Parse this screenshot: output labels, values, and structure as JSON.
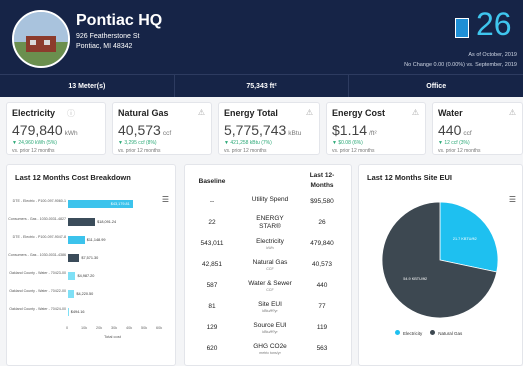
{
  "building": {
    "name": "Pontiac HQ",
    "address1": "926 Featherstone St",
    "address2": "Pontiac, MI 48342"
  },
  "energy_star": {
    "score": "26",
    "as_of": "As of October, 2019",
    "change": "No Change 0.00 (0.00%) vs. September, 2019"
  },
  "stats": {
    "meters": "13 Meter(s)",
    "area": "75,343 ft²",
    "type": "Office"
  },
  "cards": [
    {
      "title": "Electricity",
      "value": "479,840",
      "unit": "kWh",
      "change": "▼ 24,960 kWh (5%)",
      "period": "vs. prior 12 months"
    },
    {
      "title": "Natural Gas",
      "value": "40,573",
      "unit": "ccf",
      "change": "▼ 3,295 ccf (8%)",
      "period": "vs. prior 12 months"
    },
    {
      "title": "Energy Total",
      "value": "5,775,743",
      "unit": "kBtu",
      "change": "▼ 421,258 kBtu (7%)",
      "period": "vs. prior 12 months"
    },
    {
      "title": "Energy Cost",
      "value": "$1.14",
      "unit": "/ft²",
      "change": "▼ $0.08 (6%)",
      "period": "vs. prior 12 months"
    },
    {
      "title": "Water",
      "value": "440",
      "unit": "ccf",
      "change": "▼ 12 ccf (3%)",
      "period": "vs. prior 12 months"
    }
  ],
  "cost_panel": {
    "title": "Last 12 Months Cost Breakdown",
    "xaxis_title": "Total cost"
  },
  "table": {
    "head_baseline": "Baseline",
    "head_last_a": "Last 12-",
    "head_last_b": "Months",
    "rows": [
      {
        "baseline": "--",
        "metric": "Utility Spend",
        "sub": "",
        "last": "$95,580"
      },
      {
        "baseline": "22",
        "metric": "ENERGY STAR®",
        "sub": "",
        "last": "26"
      },
      {
        "baseline": "543,011",
        "metric": "Electricity",
        "sub": "kWh",
        "last": "479,840"
      },
      {
        "baseline": "42,851",
        "metric": "Natural Gas",
        "sub": "CCF",
        "last": "40,573"
      },
      {
        "baseline": "587",
        "metric": "Water & Sewer",
        "sub": "CCF",
        "last": "440"
      },
      {
        "baseline": "81",
        "metric": "Site EUI",
        "sub": "kBtu/ft²/yr",
        "last": "77"
      },
      {
        "baseline": "129",
        "metric": "Source EUI",
        "sub": "kBtu/ft²/yr",
        "last": "119"
      },
      {
        "baseline": "620",
        "metric": "GHG CO2e",
        "sub": "metric tons/yr",
        "last": "563"
      }
    ]
  },
  "eui_panel": {
    "title": "Last 12 Months Site EUI"
  },
  "chart_data": [
    {
      "type": "bar",
      "title": "Last 12 Months Cost Breakdown",
      "xlabel": "Total cost",
      "categories": [
        "DTE - Electric - P100-097-9060-1",
        "Consumers - Gas - 1030-0031-4827",
        "DTE - Electric - P100-097-9047-8",
        "Consumers - Gas - 1030-0031-4386",
        "Oakland County - Water - 70423-00",
        "Oakland County - Water - 70422-00",
        "Oakland County - Water - 70424-00"
      ],
      "values": [
        43179.81,
        18091.24,
        11148.99,
        7571.3,
        4987.2,
        4220.5,
        494.16
      ],
      "value_labels": [
        "$43,179.81",
        "$18,091.24",
        "$11,148.99",
        "$7,571.30",
        "$4,987.20",
        "$4,220.50",
        "$494.16"
      ],
      "colors": [
        "#3cc3ec",
        "#3b4c5a",
        "#3cc3ec",
        "#3b4c5a",
        "#7fe0f6",
        "#7fe0f6",
        "#7fe0f6"
      ],
      "xticks": [
        "0",
        "10k",
        "20k",
        "30k",
        "40k",
        "50k",
        "60k"
      ],
      "xlim": [
        0,
        60000
      ]
    },
    {
      "type": "pie",
      "title": "Last 12 Months Site EUI",
      "labels": [
        "Electricity",
        "Natural Gas"
      ],
      "values": [
        21.7,
        54.9
      ],
      "slice_labels": [
        "21.7 KBTU/ft2",
        "54.9 KBTU/ft2"
      ],
      "colors": [
        "#1ec0f0",
        "#3d4851"
      ]
    }
  ]
}
